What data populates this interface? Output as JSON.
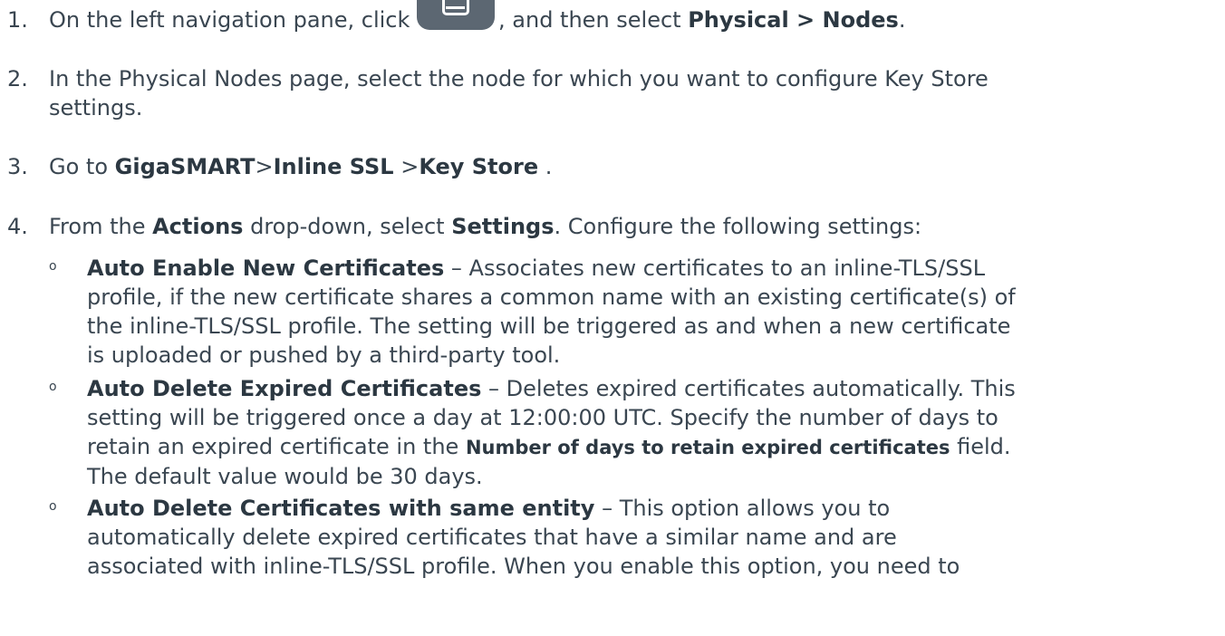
{
  "steps": [
    {
      "number": "1.",
      "before_icon": "On the left navigation pane, click ",
      "icon": "server-device-icon",
      "after_icon": ", and then select ",
      "bold": "Physical > Nodes",
      "end": "."
    },
    {
      "number": "2.",
      "line1": "In the Physical Nodes page, select the node for which you want to configure Key Store",
      "line2": "settings."
    },
    {
      "number": "3.",
      "prefix": "Go to ",
      "bold1": "GigaSMART",
      "sep1": ">",
      "bold2": "Inline SSL",
      "sep2": " >",
      "bold3": "Key Store",
      "end": " ."
    },
    {
      "number": "4.",
      "prefix": "From the ",
      "bold1": "Actions",
      "mid": " drop-down, select ",
      "bold2": "Settings",
      "end": ". Configure the following settings:"
    }
  ],
  "bullets": [
    {
      "marker": "o",
      "bold": "Auto Enable New Certificates",
      "line1_rest": " – Associates new certificates to an inline-TLS/SSL",
      "line2": "profile, if the new certificate shares a common name with an existing certificate(s) of",
      "line3": "the inline-TLS/SSL profile. The setting will be triggered as and when a new certificate",
      "line4": "is uploaded or pushed by a third-party tool."
    },
    {
      "marker": "o",
      "bold": "Auto Delete Expired Certificates",
      "line1_rest": " – Deletes expired certificates automatically. This",
      "line2": "setting will be triggered once a day at 12:00:00 UTC. Specify the number of days to",
      "line3_pre": "retain an expired certificate in the ",
      "line3_bold": "Number of days to retain expired certificates",
      "line3_post": " field.",
      "line4": "The default value would be 30 days."
    },
    {
      "marker": "o",
      "bold": "Auto Delete Certificates with same entity",
      "line1_rest": " – This option allows you to",
      "line2": "automatically delete expired certificates that have a similar name and are",
      "line3": "associated with inline-TLS/SSL profile. When you enable this option, you need to"
    }
  ]
}
